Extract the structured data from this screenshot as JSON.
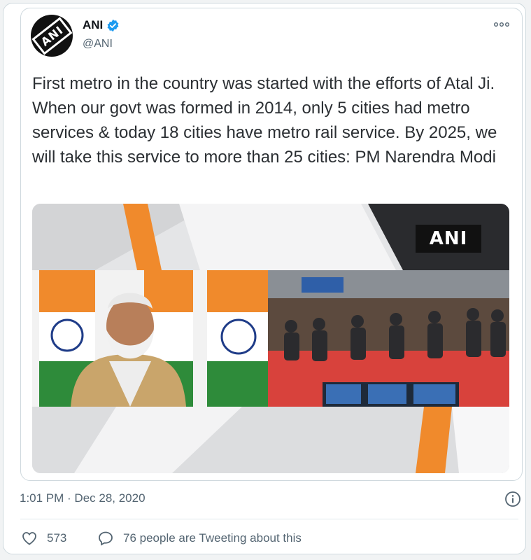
{
  "tweet": {
    "author_name": "ANI",
    "handle": "@ANI",
    "avatar_text": "ANI",
    "text": "First metro in the country was started with the efforts of Atal Ji. When our govt was formed in 2014, only 5 cities had metro services & today 18 cities have metro rail service. By 2025, we will take this service to more than 25 cities: PM Narendra Modi",
    "media_badge": "ANI",
    "timestamp": "1:01 PM · Dec 28, 2020",
    "likes": "573",
    "talking": "76 people are Tweeting about this"
  },
  "icons": {
    "verified": "verified-badge-icon",
    "more": "more-options-icon",
    "info": "info-icon",
    "like": "heart-icon",
    "reply": "speech-bubble-icon"
  },
  "colors": {
    "verified": "#1d9bf0",
    "secondary_text": "#536471",
    "saffron": "#f08a2c",
    "green": "#2e8b3a"
  }
}
